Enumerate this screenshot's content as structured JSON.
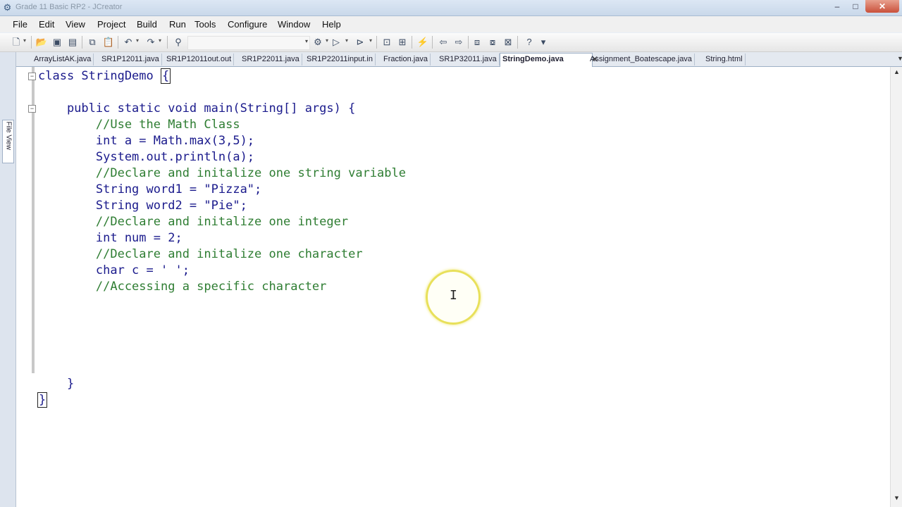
{
  "window": {
    "title": "Grade 11 Basic RP2 - JCreator",
    "min_glyph": "–",
    "max_glyph": "□",
    "close_glyph": "✕"
  },
  "menu": [
    "File",
    "Edit",
    "View",
    "Project",
    "Build",
    "Run",
    "Tools",
    "Configure",
    "Window",
    "Help"
  ],
  "tabs": [
    {
      "label": "ArrayListAK.java"
    },
    {
      "label": "SR1P12011.java"
    },
    {
      "label": "SR1P12011out.out"
    },
    {
      "label": "SR1P22011.java"
    },
    {
      "label": "SR1P22011input.in"
    },
    {
      "label": "Fraction.java"
    },
    {
      "label": "SR1P32011.java"
    },
    {
      "label": "StringDemo.java",
      "active": true
    },
    {
      "label": "Assignment_Boatescape.java"
    },
    {
      "label": "String.html"
    }
  ],
  "tab_close_glyph": "✕",
  "side_panel": {
    "label": "File View"
  },
  "code_lines": [
    {
      "text": "class StringDemo ",
      "suffix": "{",
      "kind": "code"
    },
    {
      "text": "",
      "kind": "code"
    },
    {
      "text": "    public static void main(String[] args) {",
      "kind": "code"
    },
    {
      "text": "        //Use the Math Class",
      "kind": "comment"
    },
    {
      "text": "        int a = Math.max(3,5);",
      "kind": "code"
    },
    {
      "text": "        System.out.println(a);",
      "kind": "code"
    },
    {
      "text": "        //Declare and initalize one string variable",
      "kind": "comment"
    },
    {
      "text": "        String word1 = \"Pizza\";",
      "kind": "code"
    },
    {
      "text": "        String word2 = \"Pie\";",
      "kind": "code"
    },
    {
      "text": "        //Declare and initalize one integer",
      "kind": "comment"
    },
    {
      "text": "        int num = 2;",
      "kind": "code"
    },
    {
      "text": "        //Declare and initalize one character",
      "kind": "comment"
    },
    {
      "text": "        char c = ' ';",
      "kind": "code"
    },
    {
      "text": "        //Accessing a specific character",
      "kind": "comment"
    },
    {
      "text": "",
      "kind": "code"
    },
    {
      "text": "",
      "kind": "code"
    },
    {
      "text": "",
      "kind": "code"
    },
    {
      "text": "",
      "kind": "code"
    },
    {
      "text": "",
      "kind": "code"
    },
    {
      "text": "    }",
      "kind": "code"
    },
    {
      "text": "",
      "prefix": "}",
      "kind": "code"
    }
  ],
  "colors": {
    "code": "#1a1a8c",
    "comment": "#2e7d32",
    "accent": "#2b64b5"
  },
  "icons": [
    "new-file-icon",
    "open-icon",
    "save-icon",
    "save-all-icon",
    "copy-icon",
    "paste-icon",
    "undo-icon",
    "redo-icon",
    "find-icon",
    "compile-icon",
    "run-icon",
    "debug-icon",
    "back-icon",
    "forward-icon",
    "help-icon"
  ]
}
